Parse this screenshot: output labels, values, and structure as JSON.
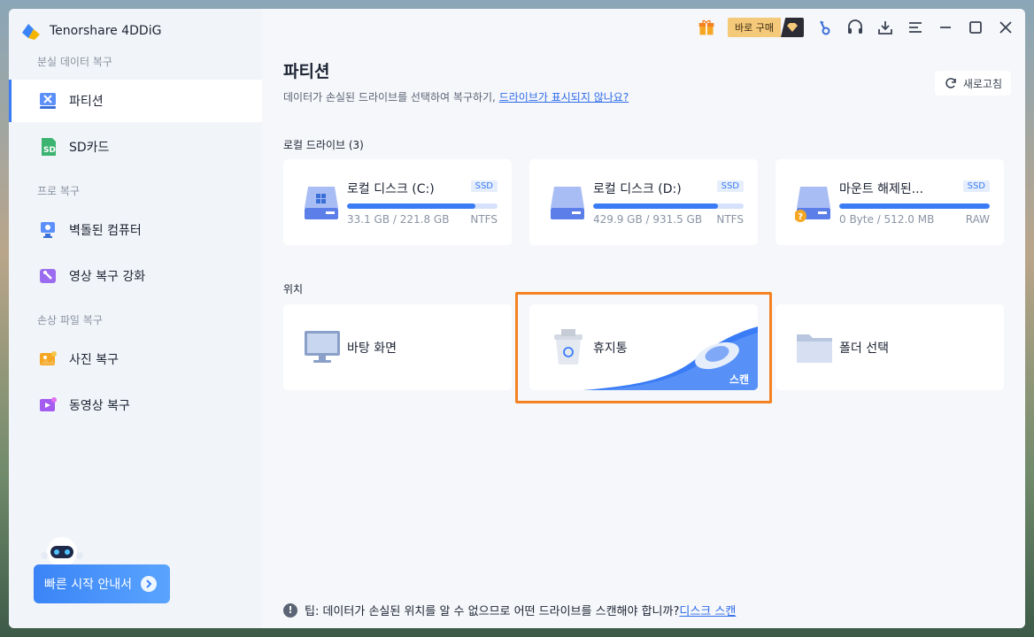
{
  "app": {
    "title": "Tenorshare 4DDiG"
  },
  "sidebar": {
    "sections": [
      {
        "label": "분실 데이터 복구"
      },
      {
        "label": "프로 복구"
      },
      {
        "label": "손상 파일 복구"
      }
    ],
    "items": [
      {
        "label": "파티션",
        "icon": "partition-icon",
        "active": true
      },
      {
        "label": "SD카드",
        "icon": "sd-card-icon"
      },
      {
        "label": "벽돌된 컴퓨터",
        "icon": "crashed-computer-icon"
      },
      {
        "label": "영상 복구 강화",
        "icon": "video-repair-icon"
      },
      {
        "label": "사진 복구",
        "icon": "photo-repair-icon"
      },
      {
        "label": "동영상 복구",
        "icon": "video-icon"
      }
    ],
    "quick_start": "빠른 시작 안내서"
  },
  "toolbar": {
    "buy_label": "바로 구매"
  },
  "main": {
    "title": "파티션",
    "subtitle": "데이터가 손실된 드라이브를 선택하여 복구하기,",
    "subtitle_link": "드라이브가 표시되지 않나요?",
    "refresh_label": "새로고침",
    "local_drives_label": "로컬 드라이브 (3)",
    "drives": [
      {
        "name": "로컬 디스크 (C:)",
        "badge": "SSD",
        "size": "33.1 GB / 221.8 GB",
        "fs": "NTFS",
        "used_fraction": 0.85
      },
      {
        "name": "로컬 디스크 (D:)",
        "badge": "SSD",
        "size": "429.9 GB / 931.5 GB",
        "fs": "NTFS",
        "used_fraction": 0.83
      },
      {
        "name": "마운트 해제된...",
        "badge": "SSD",
        "size": "0 Byte / 512.0 MB",
        "fs": "RAW",
        "used_fraction": 1.0
      }
    ],
    "locations_label": "위치",
    "locations": [
      {
        "name": "바탕 화면",
        "icon": "desktop-icon"
      },
      {
        "name": "휴지통",
        "icon": "recycle-bin-icon",
        "scan_label": "스캔"
      },
      {
        "name": "폴더 선택",
        "icon": "folder-icon"
      }
    ],
    "tip_text": "팁: 데이터가 손실된 위치를 알 수 없으므로 어떤 드라이브를 스캔해야 합니까?",
    "tip_link": "디스크 스캔",
    "tip_icon": "!"
  },
  "colors": {
    "accent": "#3a7cf6",
    "highlight": "#f58220"
  }
}
